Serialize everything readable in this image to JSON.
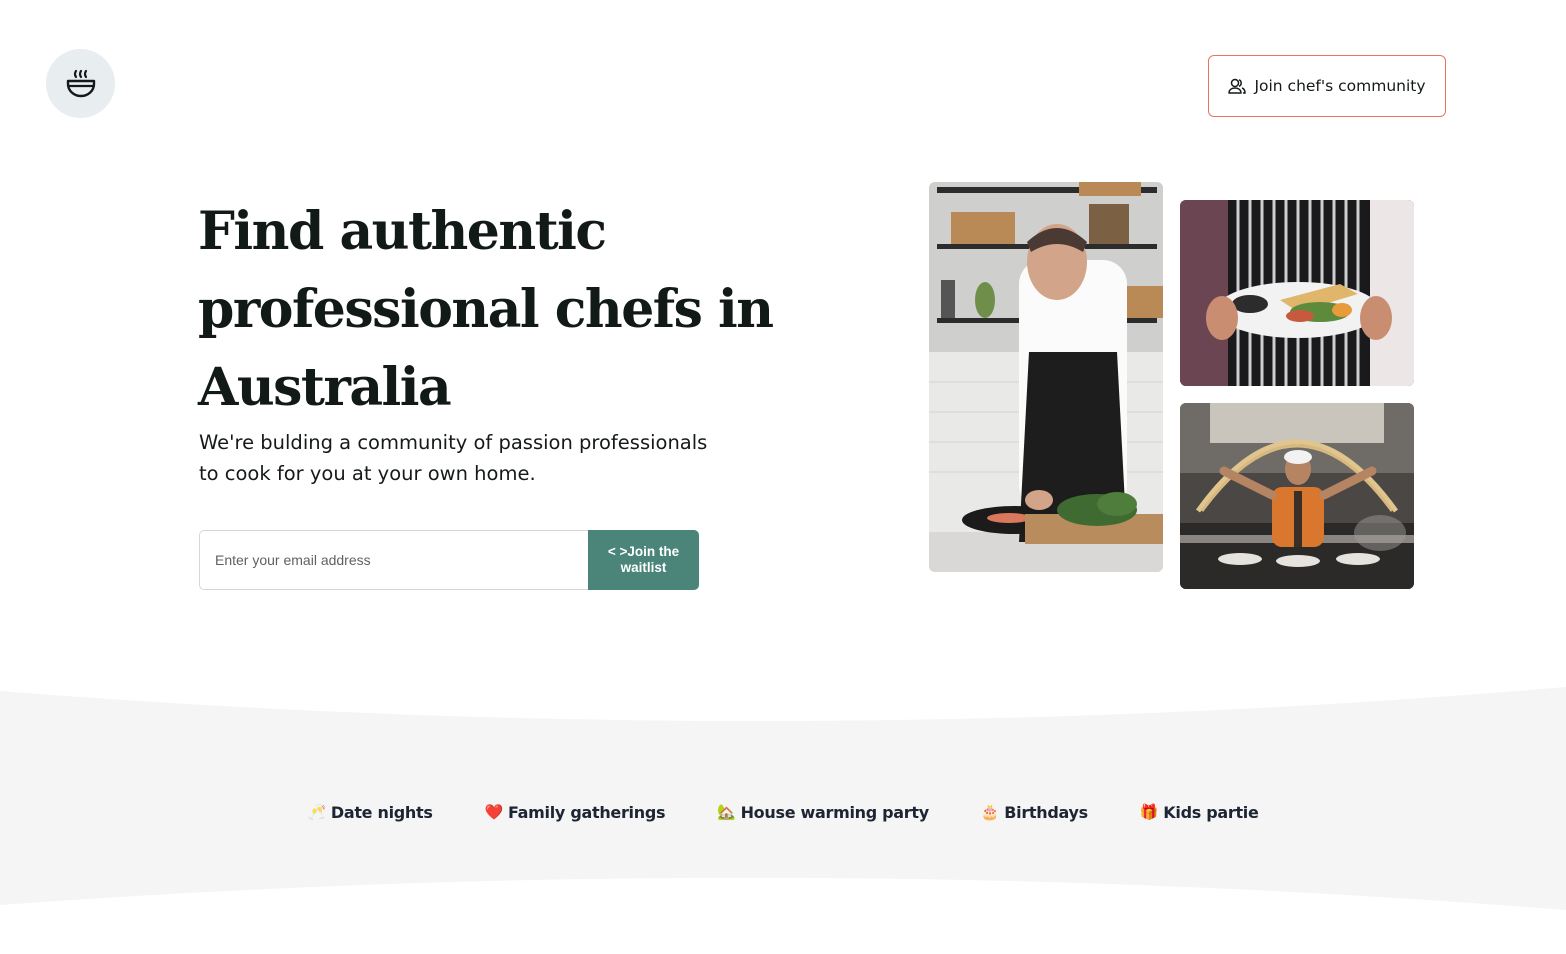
{
  "header": {
    "logo_icon": "steaming-bowl-icon",
    "community_button": {
      "label": "Join chef's community",
      "icon": "users-icon"
    }
  },
  "hero": {
    "headline": "Find authentic professional chefs in Australia",
    "subtitle": "We're bulding a community of passion professionals to cook for you at your own home.",
    "email_placeholder": "Enter your email address",
    "waitlist_button_label": "< >Join the waitlist"
  },
  "images": [
    {
      "subject": "chef in black apron chopping greens in a kitchen"
    },
    {
      "subject": "chef in striped apron holding a plated dish"
    },
    {
      "subject": "chef stretching noodles in a commercial kitchen"
    }
  ],
  "occasions": [
    {
      "emoji": "🥂",
      "label": "Date nights"
    },
    {
      "emoji": "❤️",
      "label": "Family gatherings"
    },
    {
      "emoji": "🏡",
      "label": "House warming party"
    },
    {
      "emoji": "🎂",
      "label": "Birthdays"
    },
    {
      "emoji": "🎁",
      "label": "Kids partie"
    }
  ],
  "colors": {
    "accent_green": "#4b8579",
    "button_border": "#e5775f",
    "band_background": "#f4f5f4",
    "logo_circle": "#e8edef"
  }
}
